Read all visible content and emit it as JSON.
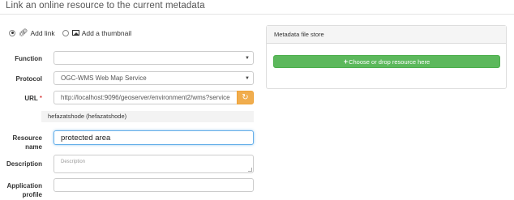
{
  "page": {
    "title": "Link an online resource to the current metadata"
  },
  "mode": {
    "options": [
      {
        "label": "Add link",
        "icon": "link-icon",
        "selected": true
      },
      {
        "label": "Add a thumbnail",
        "icon": "image-icon",
        "selected": false
      }
    ]
  },
  "form": {
    "function": {
      "label": "Function",
      "value": ""
    },
    "protocol": {
      "label": "Protocol",
      "value": "OGC-WMS Web Map Service"
    },
    "url": {
      "label": "URL",
      "required_mark": "*",
      "value": "http://localhost:9096/geoserver/environment2/wms?service",
      "button_icon": "refresh-icon"
    },
    "layer_hint": "hefazatshode (hefazatshode)",
    "resource_name": {
      "label_line1": "Resource",
      "label_line2": "name",
      "value": "protected area"
    },
    "description": {
      "label": "Description",
      "placeholder": "Description"
    },
    "application_profile": {
      "label_line1": "Application",
      "label_line2": "profile",
      "value": ""
    }
  },
  "file_store": {
    "heading": "Metadata file store",
    "button_icon": "plus-icon",
    "button_label": "Choose or drop resource here"
  },
  "colors": {
    "accent_green": "#5cb85c",
    "url_button": "#f0ad4e",
    "focus": "#66afe9"
  }
}
